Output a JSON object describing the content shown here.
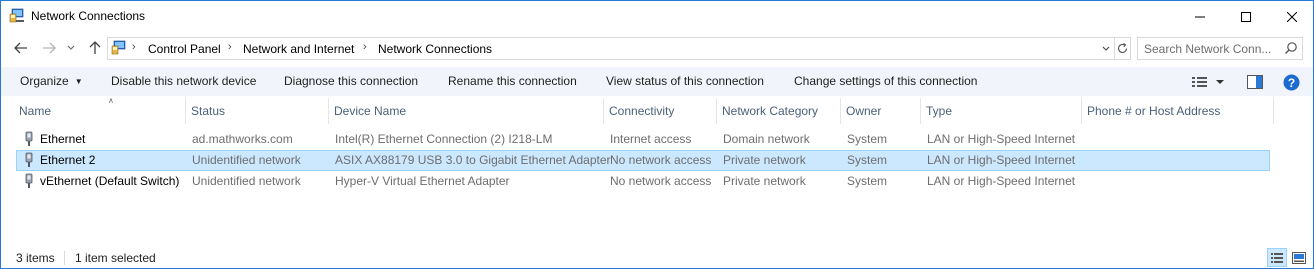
{
  "window": {
    "title": "Network Connections",
    "minimize_icon": "minimize-icon",
    "maximize_icon": "maximize-icon",
    "close_icon": "close-icon"
  },
  "address_bar": {
    "breadcrumbs": [
      "Control Panel",
      "Network and Internet",
      "Network Connections"
    ],
    "search_placeholder": "Search Network Conn..."
  },
  "command_bar": {
    "organize_label": "Organize",
    "commands": [
      "Disable this network device",
      "Diagnose this connection",
      "Rename this connection",
      "View status of this connection",
      "Change settings of this connection"
    ]
  },
  "table": {
    "columns": [
      "Name",
      "Status",
      "Device Name",
      "Connectivity",
      "Network Category",
      "Owner",
      "Type",
      "Phone # or Host Address"
    ],
    "rows": [
      {
        "name": "Ethernet",
        "status": "ad.mathworks.com",
        "device_name": "Intel(R) Ethernet Connection (2) I218-LM",
        "connectivity": "Internet access",
        "network_category": "Domain network",
        "owner": "System",
        "type": "LAN or High-Speed Internet",
        "phone": "",
        "selected": false
      },
      {
        "name": "Ethernet 2",
        "status": "Unidentified network",
        "device_name": "ASIX AX88179 USB 3.0 to Gigabit Ethernet Adapter",
        "connectivity": "No network access",
        "network_category": "Private network",
        "owner": "System",
        "type": "LAN or High-Speed Internet",
        "phone": "",
        "selected": true
      },
      {
        "name": "vEthernet (Default Switch)",
        "status": "Unidentified network",
        "device_name": "Hyper-V Virtual Ethernet Adapter",
        "connectivity": "No network access",
        "network_category": "Private network",
        "owner": "System",
        "type": "LAN or High-Speed Internet",
        "phone": "",
        "selected": false
      }
    ]
  },
  "status_bar": {
    "item_count": "3 items",
    "selection": "1 item selected"
  },
  "colors": {
    "accent": "#2b79d6",
    "selection_bg": "#cce8ff",
    "selection_border": "#99d1ff",
    "command_bar_bg": "#f1f5fb",
    "header_text": "#4c607a",
    "secondary_text": "#6d6d6d"
  }
}
